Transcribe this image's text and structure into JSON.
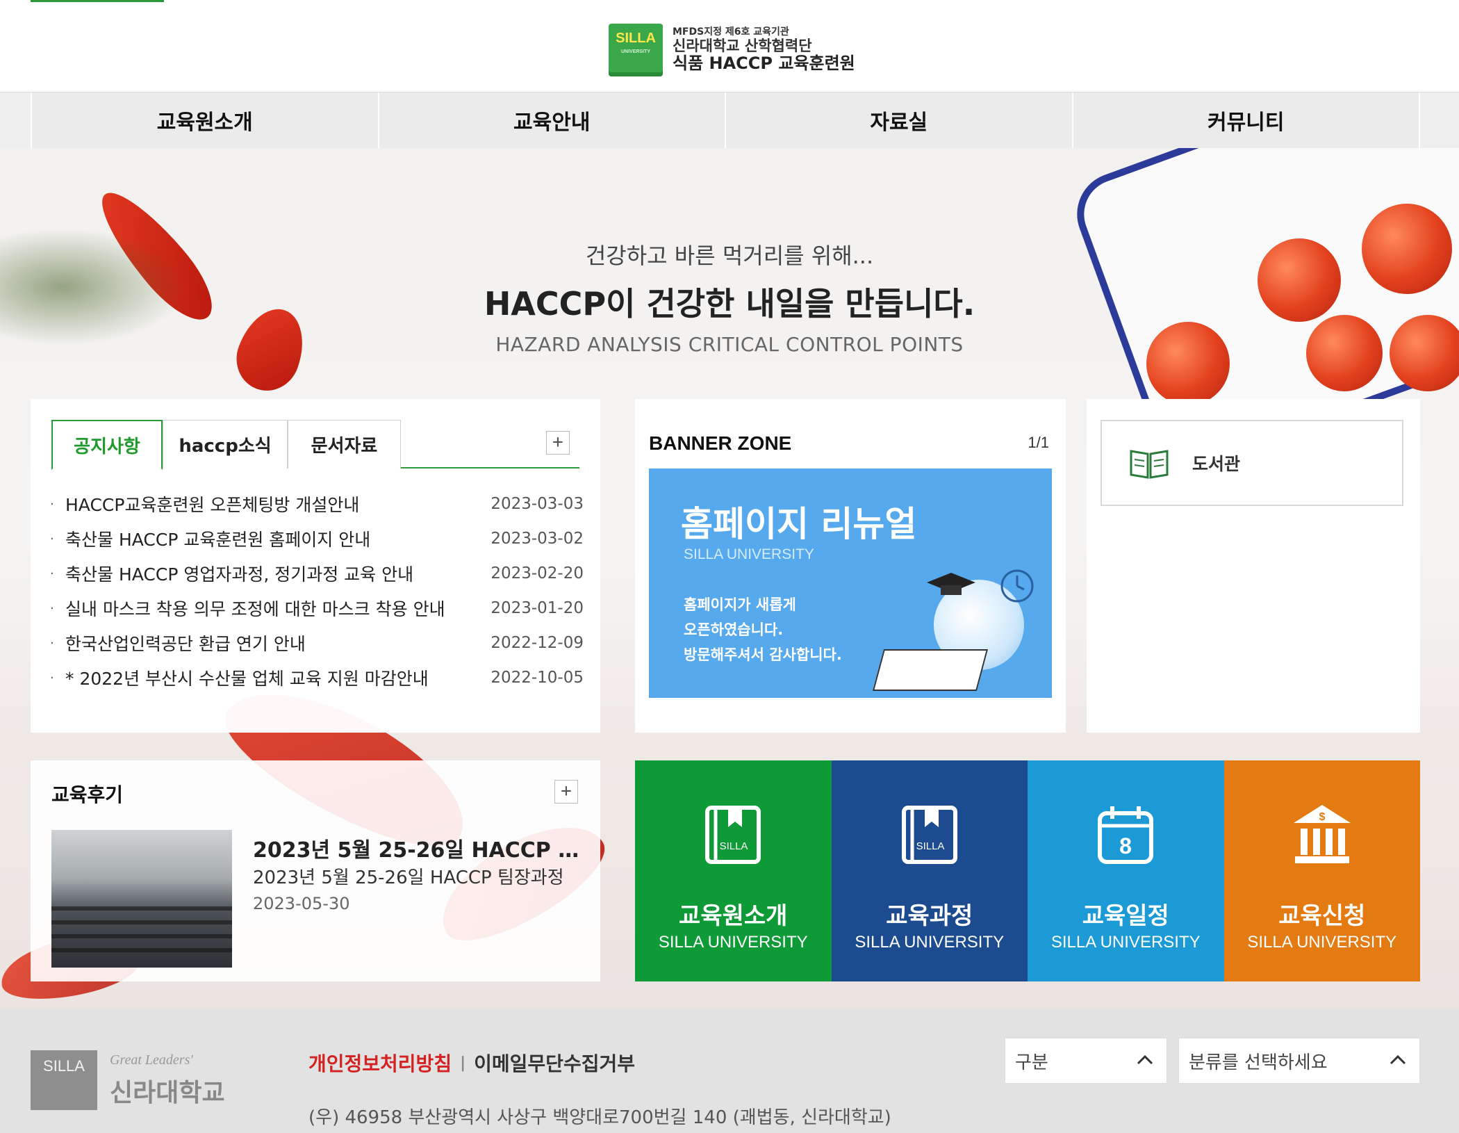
{
  "header": {
    "logo_badge": "SILLA",
    "logo_badge_sub": "UNIVERSITY",
    "logo_line1": "MFDS지정 제6호 교육기관",
    "logo_line2": "신라대학교 산학협력단",
    "logo_line3": "식품 HACCP 교육훈련원"
  },
  "nav": {
    "items": [
      "교육원소개",
      "교육안내",
      "자료실",
      "커뮤니티"
    ]
  },
  "hero": {
    "line1": "건강하고 바른 먹거리를 위해...",
    "line2": "HACCP이 건강한 내일을 만듭니다.",
    "line3": "HAZARD ANALYSIS CRITICAL CONTROL POINTS"
  },
  "notice": {
    "tabs": [
      "공지사항",
      "haccp소식",
      "문서자료"
    ],
    "more": "+",
    "items": [
      {
        "title": "HACCP교육훈련원 오픈체팅방 개설안내",
        "date": "2023-03-03"
      },
      {
        "title": "축산물 HACCP 교육훈련원 홈페이지 안내",
        "date": "2023-03-02"
      },
      {
        "title": "축산물 HACCP 영업자과정, 정기과정 교육 안내",
        "date": "2023-02-20"
      },
      {
        "title": "실내 마스크 착용 의무 조정에 대한 마스크 착용 안내",
        "date": "2023-01-20"
      },
      {
        "title": "한국산업인력공단 환급 연기 안내",
        "date": "2022-12-09"
      },
      {
        "title": "* 2022년 부산시 수산물 업체 교육 지원 마감안내",
        "date": "2022-10-05"
      }
    ]
  },
  "banner": {
    "title": "BANNER ZONE",
    "count": "1/1",
    "heading": "홈페이지 리뉴얼",
    "university": "SILLA UNIVERSITY",
    "message": "홈페이지가 새롭게\n오픈하였습니다.\n방문해주셔서 감사합니다."
  },
  "library": {
    "label": "도서관"
  },
  "review": {
    "title": "교육후기",
    "more": "+",
    "post_title": "2023년 5월 25-26일 HACCP 팀장과정",
    "post_summary": "2023년 5월 25-26일 HACCP 팀장과정",
    "post_date": "2023-05-30"
  },
  "quick_links": [
    {
      "title": "교육원소개",
      "sub": "SILLA UNIVERSITY",
      "color": "#0e9a36",
      "icon": "book-bookmark-icon"
    },
    {
      "title": "교육과정",
      "sub": "SILLA UNIVERSITY",
      "color": "#1d4b8f",
      "icon": "book-bookmark-icon"
    },
    {
      "title": "교육일정",
      "sub": "SILLA UNIVERSITY",
      "color": "#1c9ad6",
      "icon": "calendar-icon"
    },
    {
      "title": "교육신청",
      "sub": "SILLA UNIVERSITY",
      "color": "#e37a12",
      "icon": "bank-dollar-icon"
    }
  ],
  "footer": {
    "badge": "SILLA",
    "tagline": "Great Leaders'",
    "name": "신라대학교",
    "privacy": "개인정보처리방침",
    "separator": "|",
    "email_refuse": "이메일무단수집거부",
    "address": "(우) 46958 부산광역시 사상구 백양대로700번길 140 (괘법동, 신라대학교)",
    "select1": "구분",
    "select2": "분류를 선택하세요"
  },
  "colors": {
    "accent_green": "#2a9a3b",
    "privacy_red": "#d42222"
  }
}
